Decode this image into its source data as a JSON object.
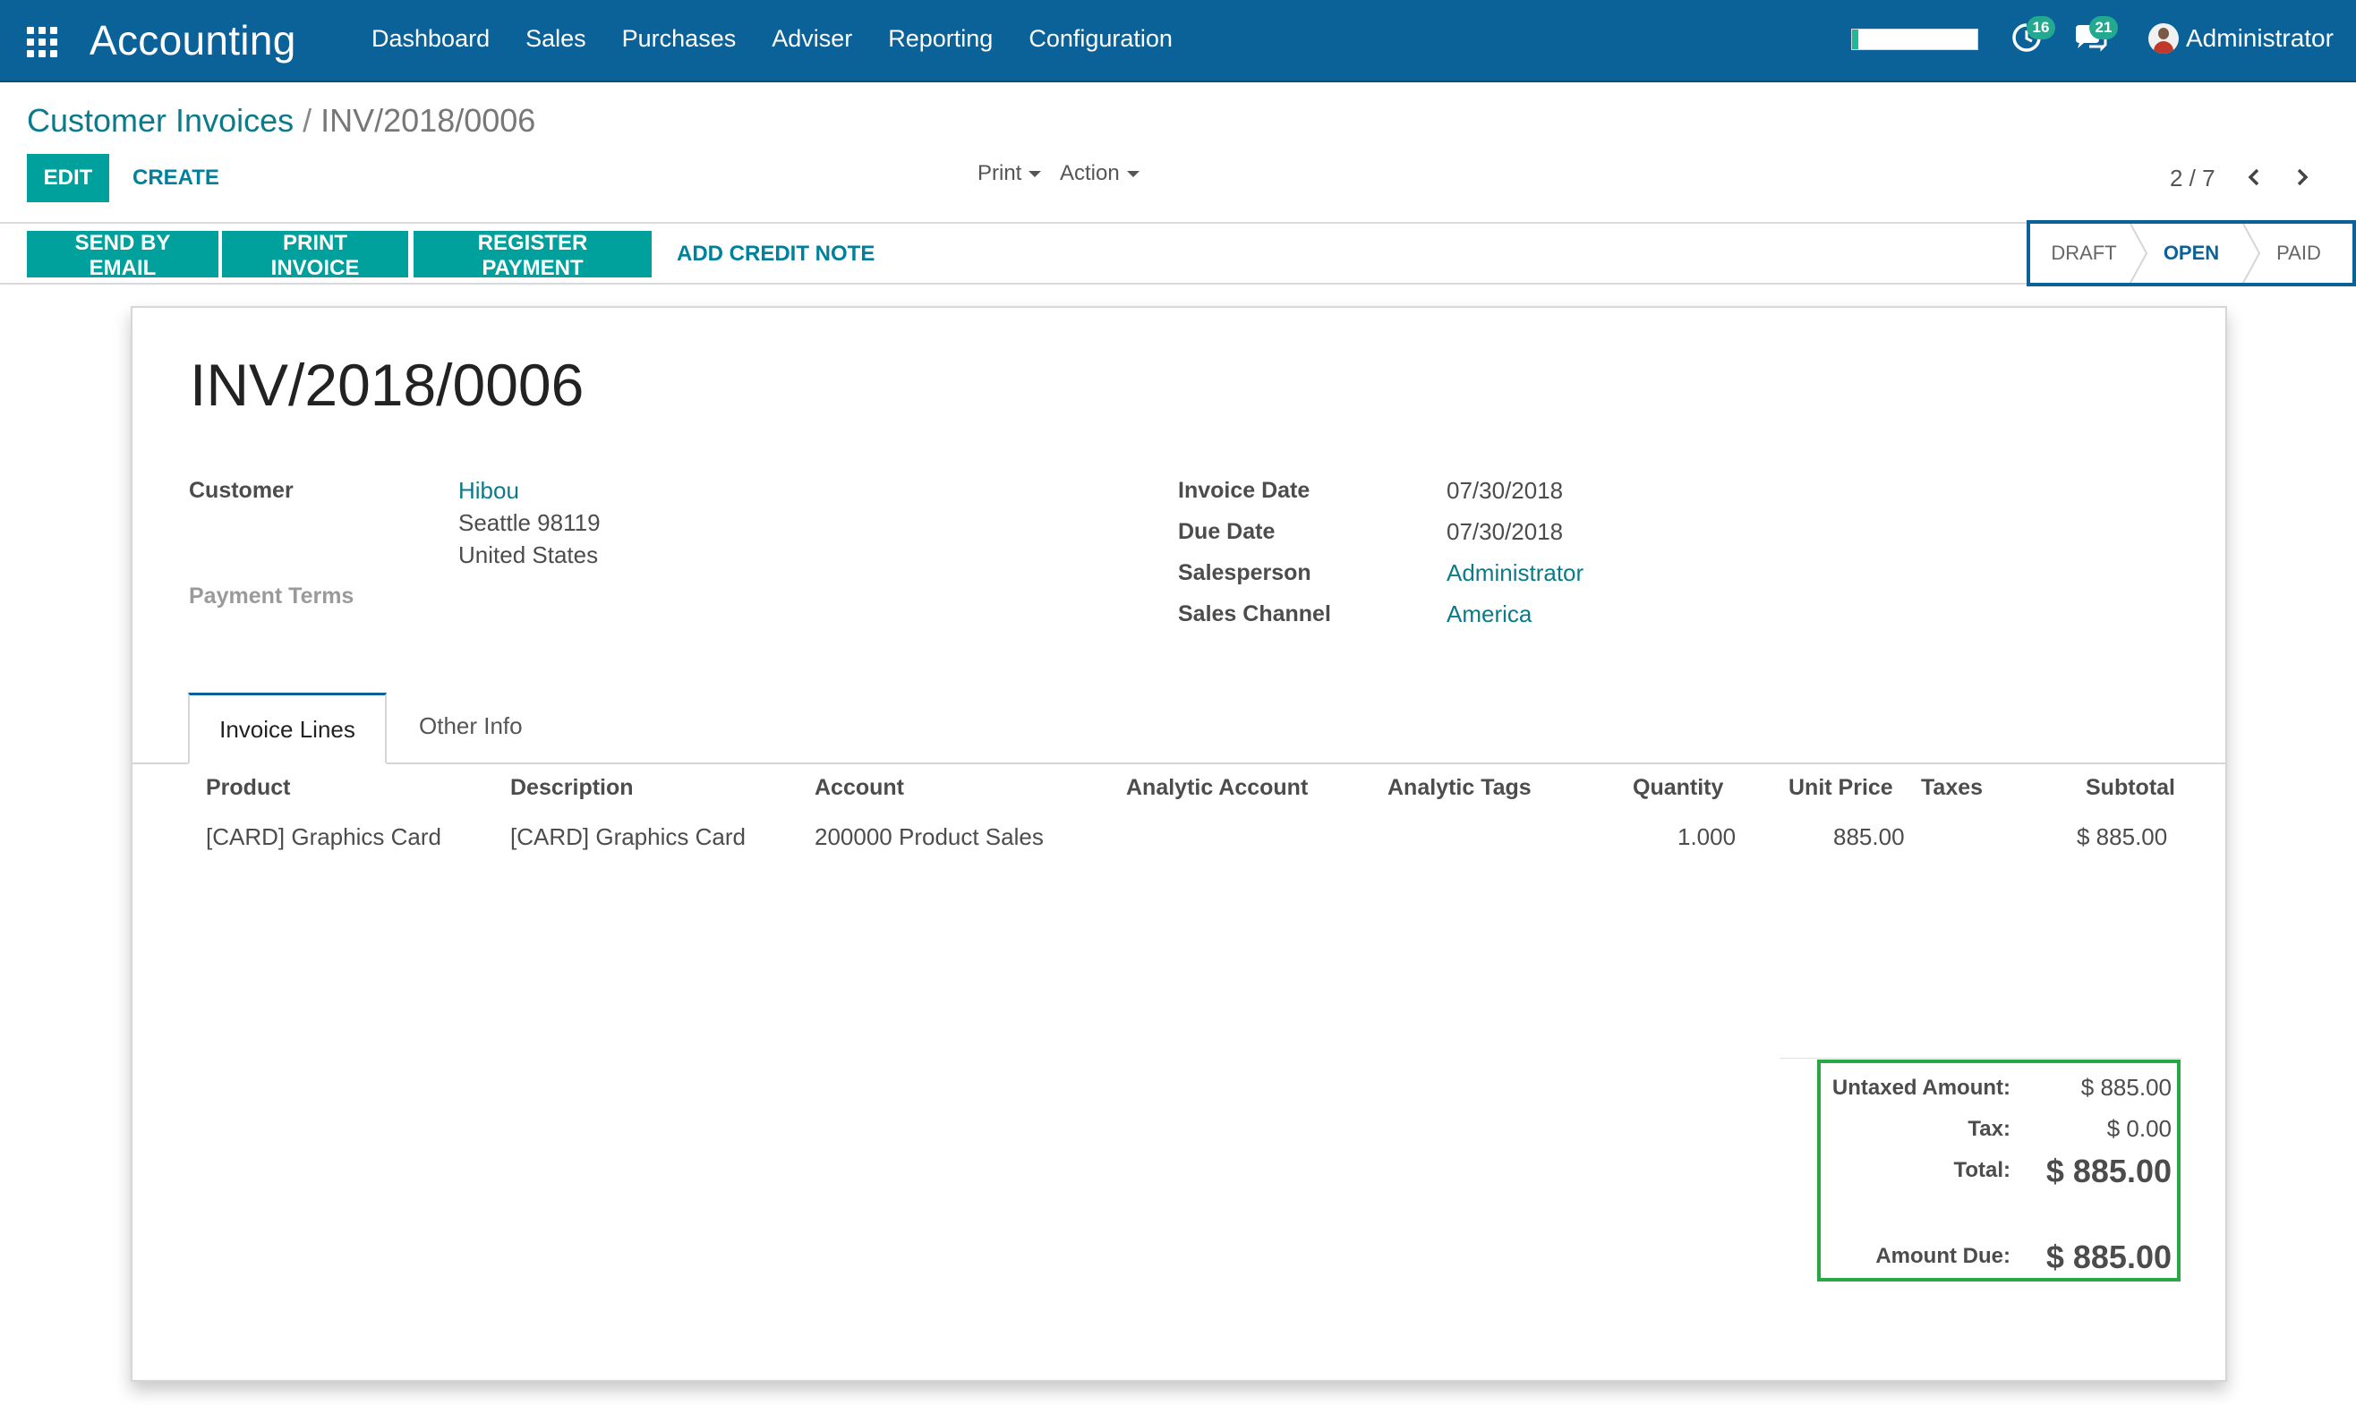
{
  "navbar": {
    "app_name": "Accounting",
    "menu": [
      "Dashboard",
      "Sales",
      "Purchases",
      "Adviser",
      "Reporting",
      "Configuration"
    ],
    "progress_fraction": 0.05,
    "activity_count": "16",
    "messages_count": "21",
    "user_name": "Administrator",
    "colors": {
      "navbar": "#0b6299",
      "badge": "#22a98f",
      "primary": "#00a09d"
    }
  },
  "breadcrumb": {
    "parent": "Customer Invoices",
    "separator": "/",
    "current": "INV/2018/0006"
  },
  "control": {
    "edit_label": "EDIT",
    "create_label": "CREATE",
    "print_label": "Print",
    "action_label": "Action",
    "pager": "2 / 7"
  },
  "statusbar": {
    "buttons": [
      "SEND BY EMAIL",
      "PRINT INVOICE",
      "REGISTER PAYMENT"
    ],
    "credit_note_label": "ADD CREDIT NOTE",
    "steps": [
      "DRAFT",
      "OPEN",
      "PAID"
    ],
    "active_step": "OPEN"
  },
  "invoice": {
    "number": "INV/2018/0006",
    "customer_label": "Customer",
    "customer_name": "Hibou",
    "customer_city": "Seattle 98119",
    "customer_country": "United States",
    "payment_terms_label": "Payment Terms",
    "invoice_date_label": "Invoice Date",
    "invoice_date": "07/30/2018",
    "due_date_label": "Due Date",
    "due_date": "07/30/2018",
    "salesperson_label": "Salesperson",
    "salesperson": "Administrator",
    "sales_channel_label": "Sales Channel",
    "sales_channel": "America"
  },
  "tabs": [
    "Invoice Lines",
    "Other Info"
  ],
  "lines": {
    "headers": [
      "Product",
      "Description",
      "Account",
      "Analytic Account",
      "Analytic Tags",
      "Quantity",
      "Unit Price",
      "Taxes",
      "Subtotal"
    ],
    "rows": [
      {
        "product": "[CARD] Graphics Card",
        "description": "[CARD] Graphics Card",
        "account": "200000 Product Sales",
        "analytic_account": "",
        "analytic_tags": "",
        "quantity": "1.000",
        "unit_price": "885.00",
        "taxes": "",
        "subtotal": "$ 885.00"
      }
    ]
  },
  "totals": {
    "untaxed_label": "Untaxed Amount:",
    "untaxed": "$ 885.00",
    "tax_label": "Tax:",
    "tax": "$ 0.00",
    "total_label": "Total:",
    "total": "$ 885.00",
    "amount_due_label": "Amount Due:",
    "amount_due": "$ 885.00"
  }
}
